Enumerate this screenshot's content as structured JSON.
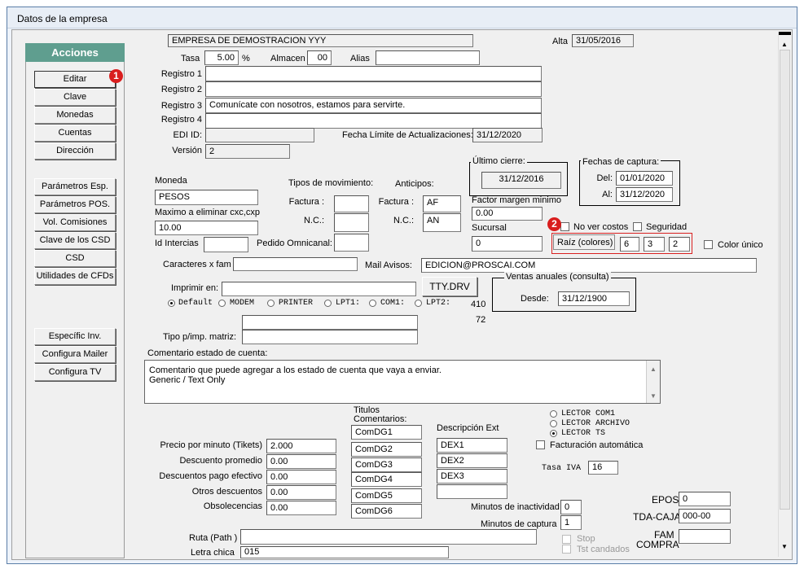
{
  "window": {
    "title": "Datos de la empresa"
  },
  "actions": {
    "header": "Acciones",
    "group1": [
      "Editar",
      "Clave",
      "Monedas",
      "Cuentas",
      "Dirección"
    ],
    "group2": [
      "Parámetros Esp.",
      "Parámetros POS.",
      "Vol. Comisiones",
      "Clave de los CSD",
      "CSD",
      "Utilidades de CFDs"
    ],
    "group3": [
      "Específic Inv.",
      "Configura Mailer",
      "Configura TV"
    ]
  },
  "badges": {
    "one": "1",
    "two": "2"
  },
  "company": {
    "name": "EMPRESA DE DEMOSTRACION YYY",
    "alta_label": "Alta",
    "alta_value": "31/05/2016"
  },
  "tasa": {
    "label": "Tasa",
    "value": "5.00",
    "unit": "%"
  },
  "almacen": {
    "label": "Almacen",
    "value": "00"
  },
  "alias": {
    "label": "Alias",
    "value": ""
  },
  "registros": [
    {
      "label": "Registro 1",
      "value": ""
    },
    {
      "label": "Registro 2",
      "value": ""
    },
    {
      "label": "Registro 3",
      "value": "Comunícate con nosotros, estamos para servirte."
    },
    {
      "label": "Registro 4",
      "value": ""
    }
  ],
  "edi": {
    "label": "EDI ID:",
    "value": ""
  },
  "fecha_limite": {
    "label": "Fecha Límite de Actualizaciones:",
    "value": "31/12/2020"
  },
  "version": {
    "label": "Versión",
    "value": "2"
  },
  "ultimo_cierre": {
    "label": "Último cierre:",
    "value": "31/12/2016"
  },
  "fechas_captura": {
    "label": "Fechas de captura:",
    "del_label": "Del:",
    "del_value": "01/01/2020",
    "al_label": "Al:",
    "al_value": "31/12/2020"
  },
  "moneda": {
    "label": "Moneda",
    "value": "PESOS"
  },
  "maximo": {
    "label": "Maximo a eliminar cxc,cxp",
    "value": "10.00"
  },
  "id_intercias": {
    "label": "Id Intercias",
    "value": ""
  },
  "tipos_mov": {
    "label": "Tipos de movimiento:",
    "factura_label": "Factura :",
    "factura_value": "",
    "nc_label": "N.C.:",
    "nc_value": ""
  },
  "anticipos": {
    "label": "Anticipos:",
    "factura_label": "Factura :",
    "factura_value": "AF",
    "nc_label": "N.C.:",
    "nc_value": "AN"
  },
  "pedido_omni": {
    "label": "Pedido Omnicanal:",
    "value": ""
  },
  "factor_margen": {
    "label": "Factor margen minimo",
    "value": "0.00"
  },
  "sucursal": {
    "label": "Sucursal",
    "value": "0"
  },
  "no_ver_costos": {
    "label": "No ver costos"
  },
  "seguridad": {
    "label": "Seguridad"
  },
  "raiz": {
    "label": "Raíz (colores)",
    "v1": "6",
    "v2": "3",
    "v3": "2"
  },
  "color_unico": {
    "label": "Color único"
  },
  "caracteres_fam": {
    "label": "Caracteres x fam",
    "value": ""
  },
  "mail_avisos": {
    "label": "Mail Avisos:",
    "value": "EDICION@PROSCAI.COM"
  },
  "imprimir": {
    "label": "Imprimir en:",
    "value": "",
    "tty_button": "TTY.DRV",
    "options": [
      "Default",
      "MODEM",
      "PRINTER",
      "LPT1:",
      "COM1:",
      "LPT2:"
    ],
    "selected": "Default",
    "n1": "410",
    "n2": "72"
  },
  "ventas_anuales": {
    "label": "Ventas anuales (consulta)",
    "desde_label": "Desde:",
    "desde_value": "31/12/1900"
  },
  "tipo_matriz": {
    "label": "Tipo p/imp. matriz:",
    "value": ""
  },
  "comentario": {
    "label": "Comentario estado de cuenta:",
    "line1": "Comentario que puede agregar a los estado de cuenta que vaya a enviar.",
    "line2": "Generic / Text Only"
  },
  "titulos": {
    "label_line1": "Titulos",
    "label_line2": "Comentarios:",
    "values": [
      "ComDG1",
      "ComDG2",
      "ComDG3",
      "ComDG4",
      "ComDG5",
      "ComDG6"
    ]
  },
  "descripcion_ext": {
    "label": "Descripción Ext",
    "values": [
      "DEX1",
      "DEX2",
      "DEX3",
      ""
    ]
  },
  "lector": {
    "options": [
      "LECTOR COM1",
      "LECTOR ARCHIVO",
      "LECTOR TS"
    ],
    "selected": "LECTOR TS"
  },
  "facturacion_auto": {
    "label": "Facturación automática"
  },
  "tasa_iva": {
    "label": "Tasa IVA",
    "value": "16"
  },
  "precios": [
    {
      "label": "Precio por minuto (Tikets)",
      "value": "2.000"
    },
    {
      "label": "Descuento promedio",
      "value": "0.00"
    },
    {
      "label": "Descuentos pago efectivo",
      "value": "0.00"
    },
    {
      "label": "Otros descuentos",
      "value": "0.00"
    },
    {
      "label": "Obsolecencias",
      "value": "0.00"
    }
  ],
  "minutos_inactividad": {
    "label": "Minutos de inactividad",
    "value": "0"
  },
  "minutos_captura": {
    "label": "Minutos de captura",
    "value": "1"
  },
  "epos": {
    "label": "EPOS",
    "value": "0"
  },
  "tda_caja": {
    "label": "TDA-CAJA",
    "value": "000-00"
  },
  "fam_compra": {
    "label1": "FAM",
    "label2": "COMPRA",
    "value": ""
  },
  "ruta": {
    "label": "Ruta (Path )",
    "value": ""
  },
  "letra_chica": {
    "label": "Letra chica",
    "value": "015"
  },
  "stop": {
    "label": "Stop"
  },
  "tst_candados": {
    "label": "Tst candados"
  }
}
